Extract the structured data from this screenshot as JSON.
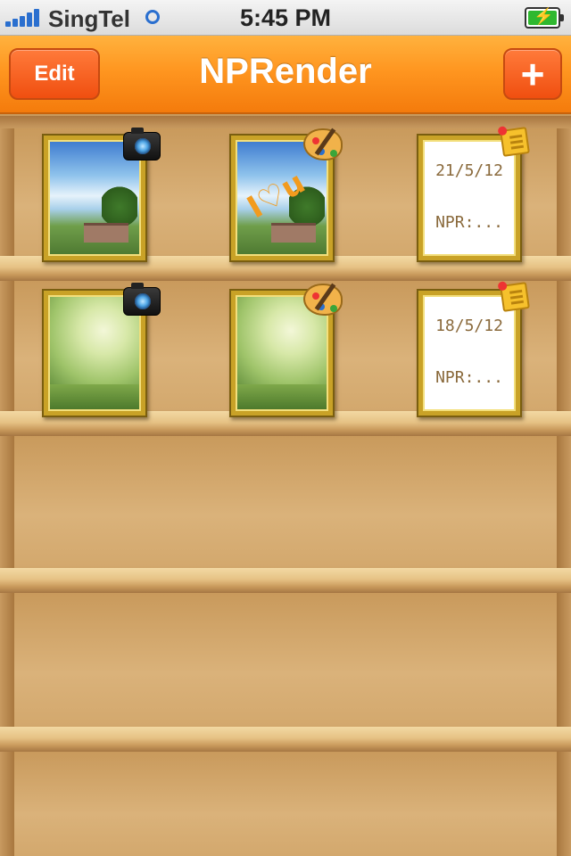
{
  "status_bar": {
    "carrier": "SingTel",
    "time": "5:45 PM"
  },
  "nav": {
    "title": "NPRender",
    "edit_label": "Edit",
    "add_label": "+"
  },
  "shelf": {
    "items": [
      {
        "type": "photo",
        "badge": "camera-icon"
      },
      {
        "type": "painting",
        "badge": "palette-icon"
      },
      {
        "type": "note",
        "badge": "sticky-note-icon",
        "date": "21/5/12",
        "text": "NPR:..."
      },
      {
        "type": "photo",
        "badge": "camera-icon"
      },
      {
        "type": "painting",
        "badge": "palette-icon"
      },
      {
        "type": "note",
        "badge": "sticky-note-icon",
        "date": "18/5/12",
        "text": "NPR:..."
      }
    ]
  },
  "colors": {
    "nav_orange": "#ff9620",
    "button_red": "#f04f10",
    "frame_gold": "#c9a227",
    "wood": "#d8ad73"
  }
}
